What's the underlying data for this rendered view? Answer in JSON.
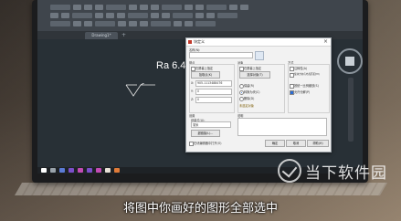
{
  "drawing": {
    "annotation_text": "Ra 6.4"
  },
  "file_tab": {
    "label": "Drawing1*"
  },
  "dialog": {
    "title": "块定义",
    "sections": {
      "name": "名称(N):",
      "base_point": "基点",
      "objects": "对象",
      "behavior": "方式",
      "settings": "设置",
      "description": "说明"
    },
    "base_point": {
      "specify_on_screen": "在屏幕上指定",
      "pick_point": "拾取点(K)",
      "x_label": "X:",
      "x_value": "905.1113488476",
      "y_label": "Y:",
      "y_value": "0",
      "z_label": "Z:",
      "z_value": "0"
    },
    "objects": {
      "specify_on_screen": "在屏幕上指定",
      "select_objects": "选择对象(T)",
      "retain": "保留(R)",
      "convert_to_block": "转换为块(C)",
      "delete": "删除(D)",
      "selected_status": "未选定对象"
    },
    "behavior": {
      "annotative": "注释性(A)",
      "match_orientation": "使块方向与布局匹配(M)",
      "scale_uniformly": "按统一比例缩放(S)",
      "allow_exploding": "允许分解(P)"
    },
    "settings": {
      "block_unit_label": "块单位(U):",
      "block_unit_value": "毫米",
      "hyperlink_button": "超链接(L)..."
    },
    "open_in_editor": "在块编辑器中打开(O)",
    "ok_button": "确定",
    "cancel_button": "取消",
    "help_button": "帮助(H)"
  },
  "watermark": {
    "text": "当下软件园"
  },
  "caption": {
    "text": "将图中你画好的图形全部选中"
  },
  "colors": {
    "canvas": "#283036",
    "ribbon": "#3f454c",
    "dialog": "#f2f2f2"
  }
}
